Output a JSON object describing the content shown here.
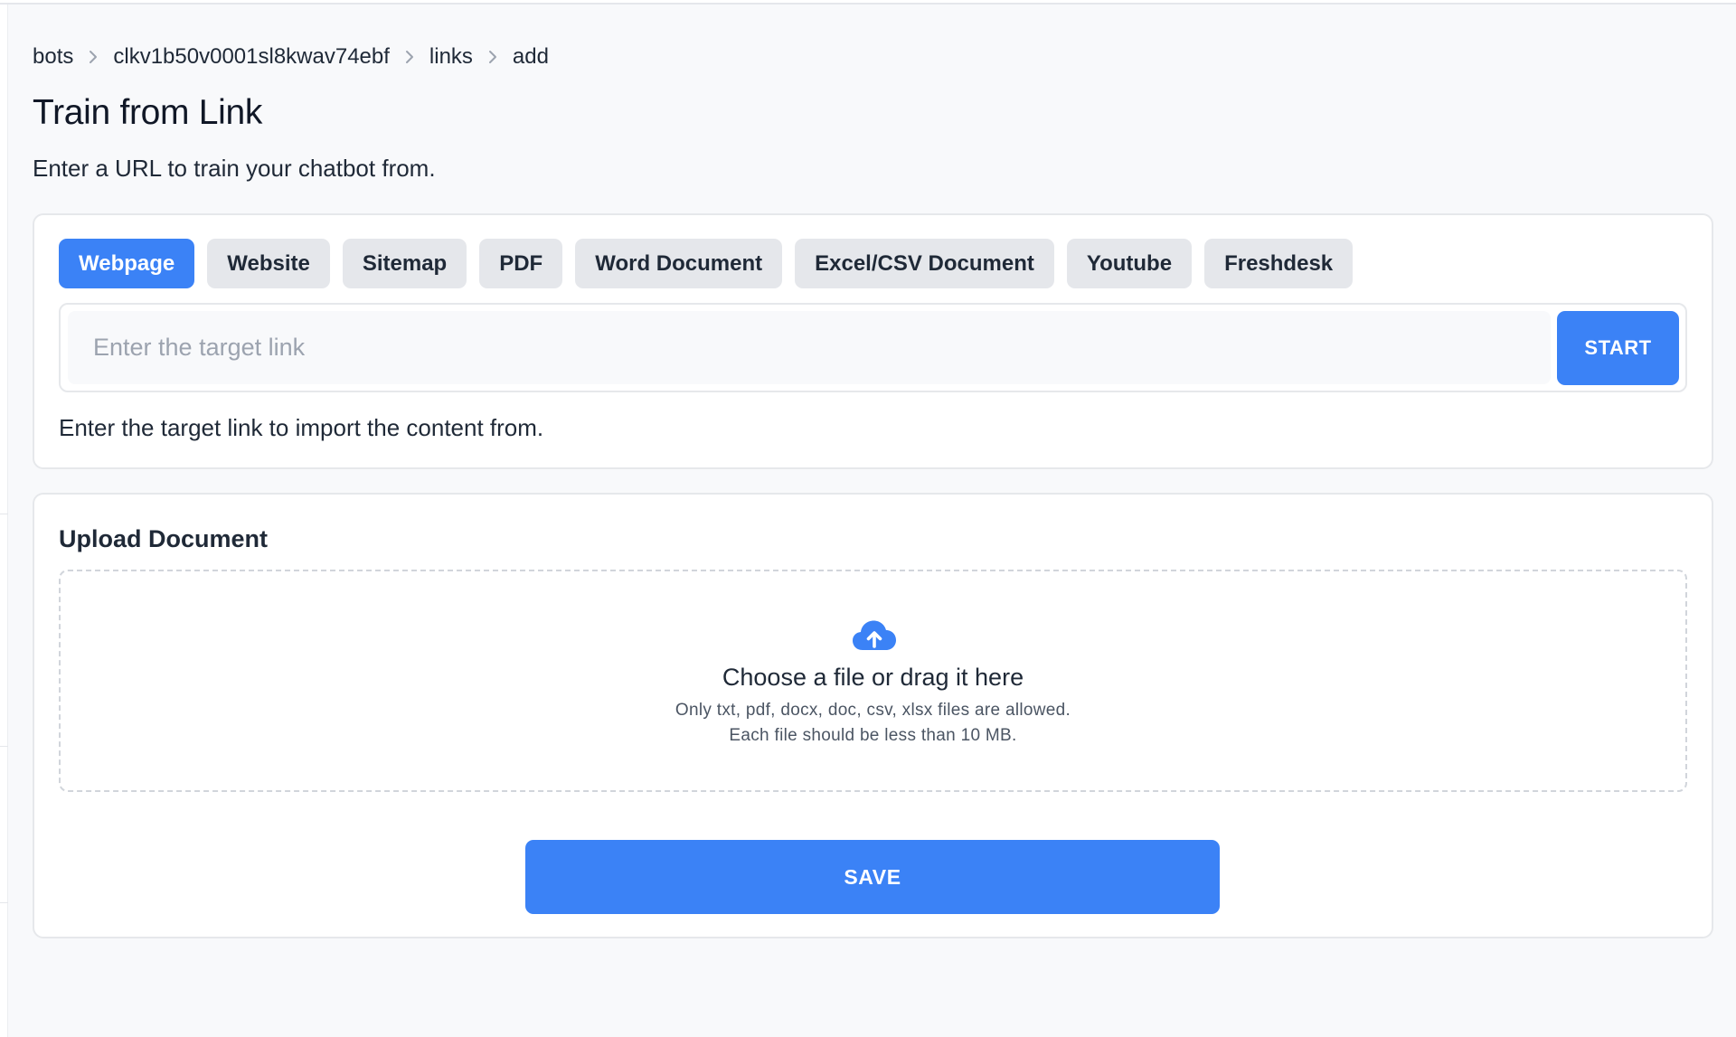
{
  "breadcrumb": {
    "items": [
      "bots",
      "clkv1b50v0001sl8kwav74ebf",
      "links",
      "add"
    ],
    "separator_icon": "chevron-right-icon"
  },
  "header": {
    "title": "Train from Link",
    "subtitle": "Enter a URL to train your chatbot from."
  },
  "source_tabs": {
    "active": "Webpage",
    "items": [
      "Webpage",
      "Website",
      "Sitemap",
      "PDF",
      "Word Document",
      "Excel/CSV Document",
      "Youtube",
      "Freshdesk"
    ]
  },
  "link_form": {
    "input_value": "",
    "input_placeholder": "Enter the target link",
    "start_label": "START",
    "help_text": "Enter the target link to import the content from."
  },
  "upload": {
    "title": "Upload Document",
    "icon": "cloud-upload-icon",
    "drop_title": "Choose a file or drag it here",
    "allowed_types_text": "Only txt, pdf, docx, doc, csv, xlsx files are allowed.",
    "size_limit_text": "Each file should be less than 10 MB.",
    "save_label": "SAVE"
  },
  "colors": {
    "accent": "#3b82f6",
    "page_background": "#f8f9fb",
    "tab_inactive": "#e5e7eb",
    "text": "#1f2937"
  }
}
